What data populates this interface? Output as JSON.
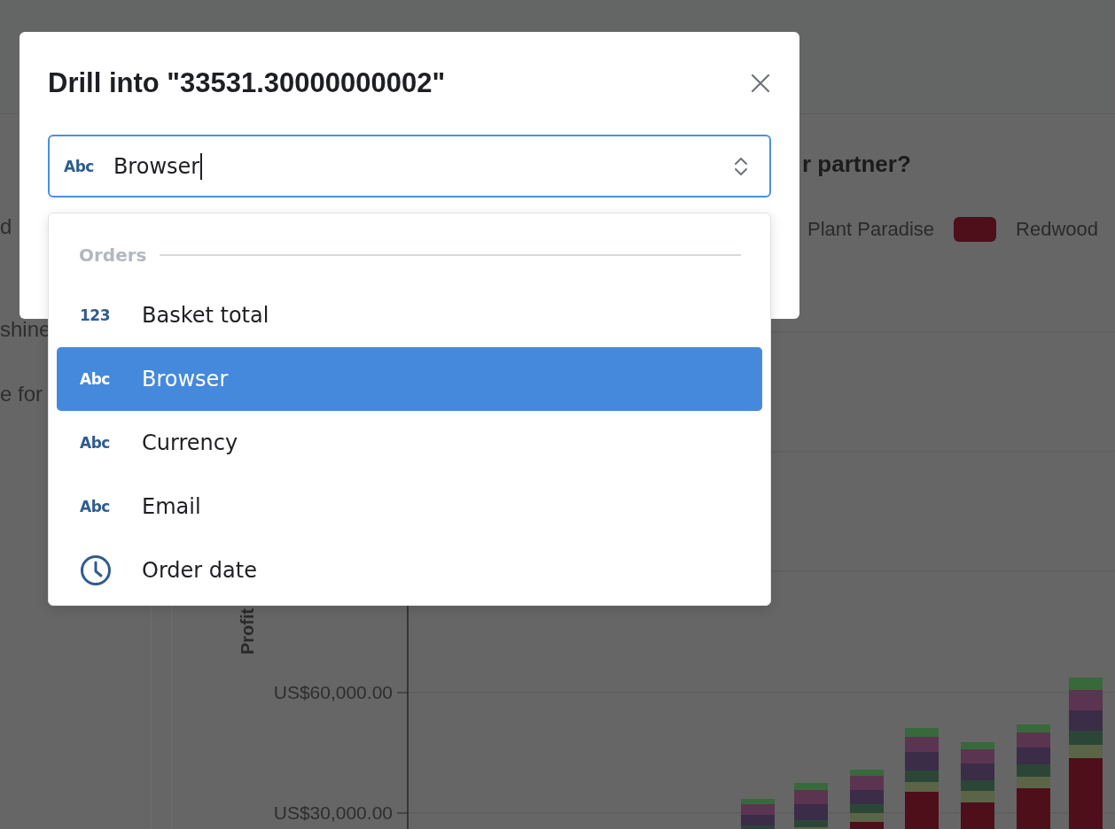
{
  "background": {
    "left_fragments": [
      "d",
      "shine",
      "e for"
    ],
    "chart_card": {
      "title": "r partner?",
      "legend": [
        {
          "label": "Plant Paradise"
        },
        {
          "label": "Redwood",
          "color": "#4e0f1a"
        }
      ],
      "y_axis_label": "Profit",
      "y_ticks": [
        "US$60,000.00",
        "US$30,000.00"
      ]
    }
  },
  "modal": {
    "title": "Drill into \"33531.30000000002\"",
    "field": {
      "kind": "text",
      "icon_label": "Abc",
      "value": "Browser"
    },
    "dropdown": {
      "group": "Orders",
      "items": [
        {
          "kind": "number",
          "icon_label": "123",
          "label": "Basket total",
          "selected": false
        },
        {
          "kind": "text",
          "icon_label": "Abc",
          "label": "Browser",
          "selected": true
        },
        {
          "kind": "text",
          "icon_label": "Abc",
          "label": "Currency",
          "selected": false
        },
        {
          "kind": "text",
          "icon_label": "Abc",
          "label": "Email",
          "selected": false
        },
        {
          "kind": "date",
          "label": "Order date",
          "selected": false
        }
      ]
    }
  }
}
